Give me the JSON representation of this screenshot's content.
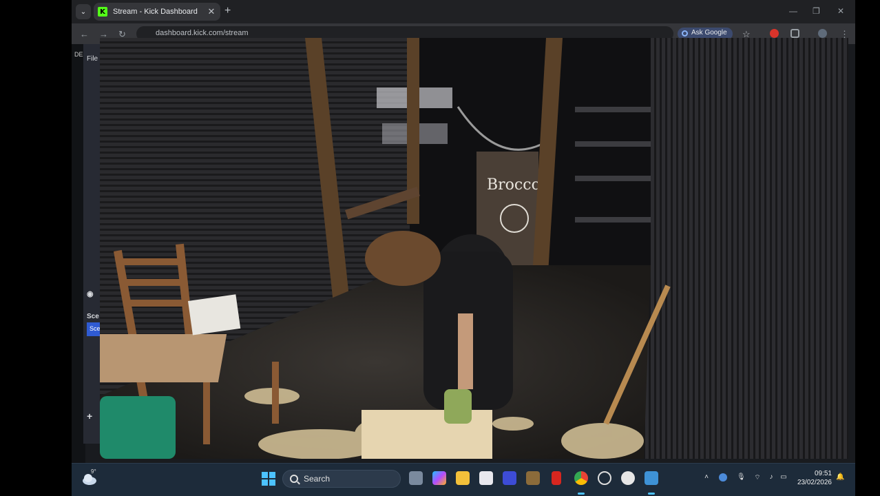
{
  "browser": {
    "tab_title": "Stream - Kick Dashboard",
    "tab_favicon_letter": "K",
    "url": "dashboard.kick.com/stream",
    "ask_google_label": "Ask Google"
  },
  "page_behind": {
    "rail_text": "DE",
    "panel_label_file": "File",
    "scenes_label": "Sce",
    "scene_button": "Sce",
    "add_icon": "plus-icon",
    "camera_icon": "camera-icon"
  },
  "video": {
    "sign_text": "Broccoli"
  },
  "taskbar": {
    "weather_temp": "9°",
    "search_label": "Search",
    "time": "09:51",
    "date": "23/02/2026"
  },
  "colors": {
    "accent_kick": "#53fc18",
    "taskbar_bg": "#1d2b3a",
    "windows_blue": "#4cc2ff"
  }
}
